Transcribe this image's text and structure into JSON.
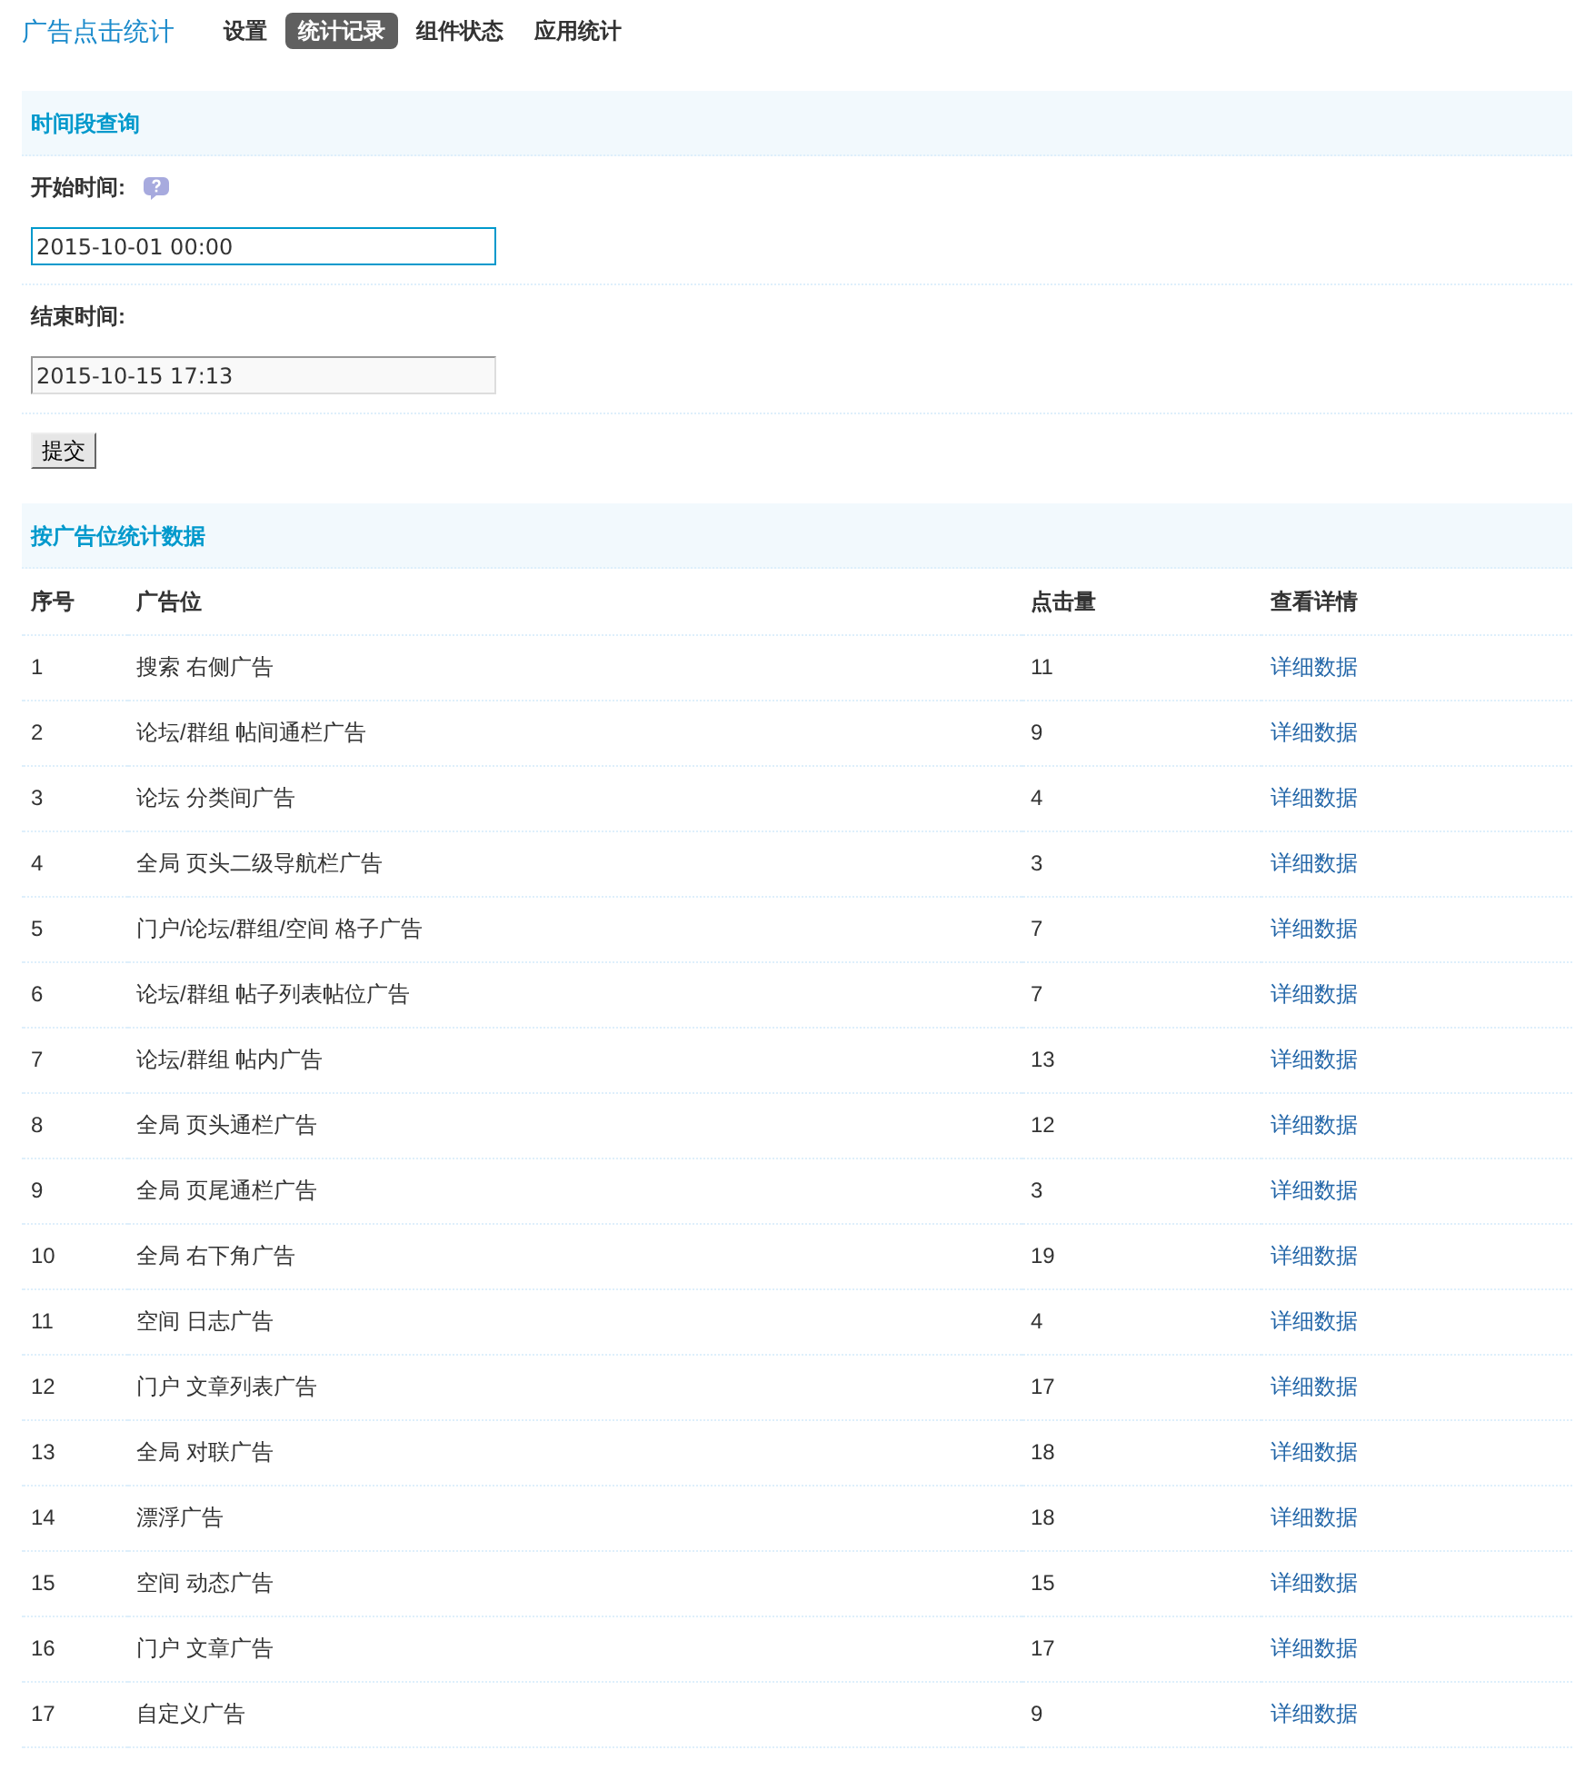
{
  "header": {
    "title": "广告点击统计",
    "tabs": [
      {
        "label": "设置",
        "selected": false
      },
      {
        "label": "统计记录",
        "selected": true
      },
      {
        "label": "组件状态",
        "selected": false
      },
      {
        "label": "应用统计",
        "selected": false
      }
    ]
  },
  "query_section": {
    "title": "时间段查询",
    "fields": [
      {
        "label": "开始时间:",
        "help": true,
        "value": "2015-10-01 00:00",
        "focused": true
      },
      {
        "label": "结束时间:",
        "help": false,
        "value": "2015-10-15 17:13",
        "focused": false
      }
    ],
    "submit": "提交"
  },
  "stats_section": {
    "title": "按广告位统计数据",
    "table": {
      "columns": [
        "序号",
        "广告位",
        "点击量",
        "查看详情"
      ],
      "rows": [
        {
          "index": "1",
          "position": "搜索 右侧广告",
          "clicks": "11",
          "action": "详细数据"
        },
        {
          "index": "2",
          "position": "论坛/群组 帖间通栏广告",
          "clicks": "9",
          "action": "详细数据"
        },
        {
          "index": "3",
          "position": "论坛 分类间广告",
          "clicks": "4",
          "action": "详细数据"
        },
        {
          "index": "4",
          "position": "全局 页头二级导航栏广告",
          "clicks": "3",
          "action": "详细数据"
        },
        {
          "index": "5",
          "position": "门户/论坛/群组/空间 格子广告",
          "clicks": "7",
          "action": "详细数据"
        },
        {
          "index": "6",
          "position": "论坛/群组 帖子列表帖位广告",
          "clicks": "7",
          "action": "详细数据"
        },
        {
          "index": "7",
          "position": "论坛/群组 帖内广告",
          "clicks": "13",
          "action": "详细数据"
        },
        {
          "index": "8",
          "position": "全局 页头通栏广告",
          "clicks": "12",
          "action": "详细数据"
        },
        {
          "index": "9",
          "position": "全局 页尾通栏广告",
          "clicks": "3",
          "action": "详细数据"
        },
        {
          "index": "10",
          "position": "全局 右下角广告",
          "clicks": "19",
          "action": "详细数据"
        },
        {
          "index": "11",
          "position": "空间 日志广告",
          "clicks": "4",
          "action": "详细数据"
        },
        {
          "index": "12",
          "position": "门户 文章列表广告",
          "clicks": "17",
          "action": "详细数据"
        },
        {
          "index": "13",
          "position": "全局 对联广告",
          "clicks": "18",
          "action": "详细数据"
        },
        {
          "index": "14",
          "position": "漂浮广告",
          "clicks": "18",
          "action": "详细数据"
        },
        {
          "index": "15",
          "position": "空间 动态广告",
          "clicks": "15",
          "action": "详细数据"
        },
        {
          "index": "16",
          "position": "门户 文章广告",
          "clicks": "17",
          "action": "详细数据"
        },
        {
          "index": "17",
          "position": "自定义广告",
          "clicks": "9",
          "action": "详细数据"
        }
      ]
    }
  }
}
